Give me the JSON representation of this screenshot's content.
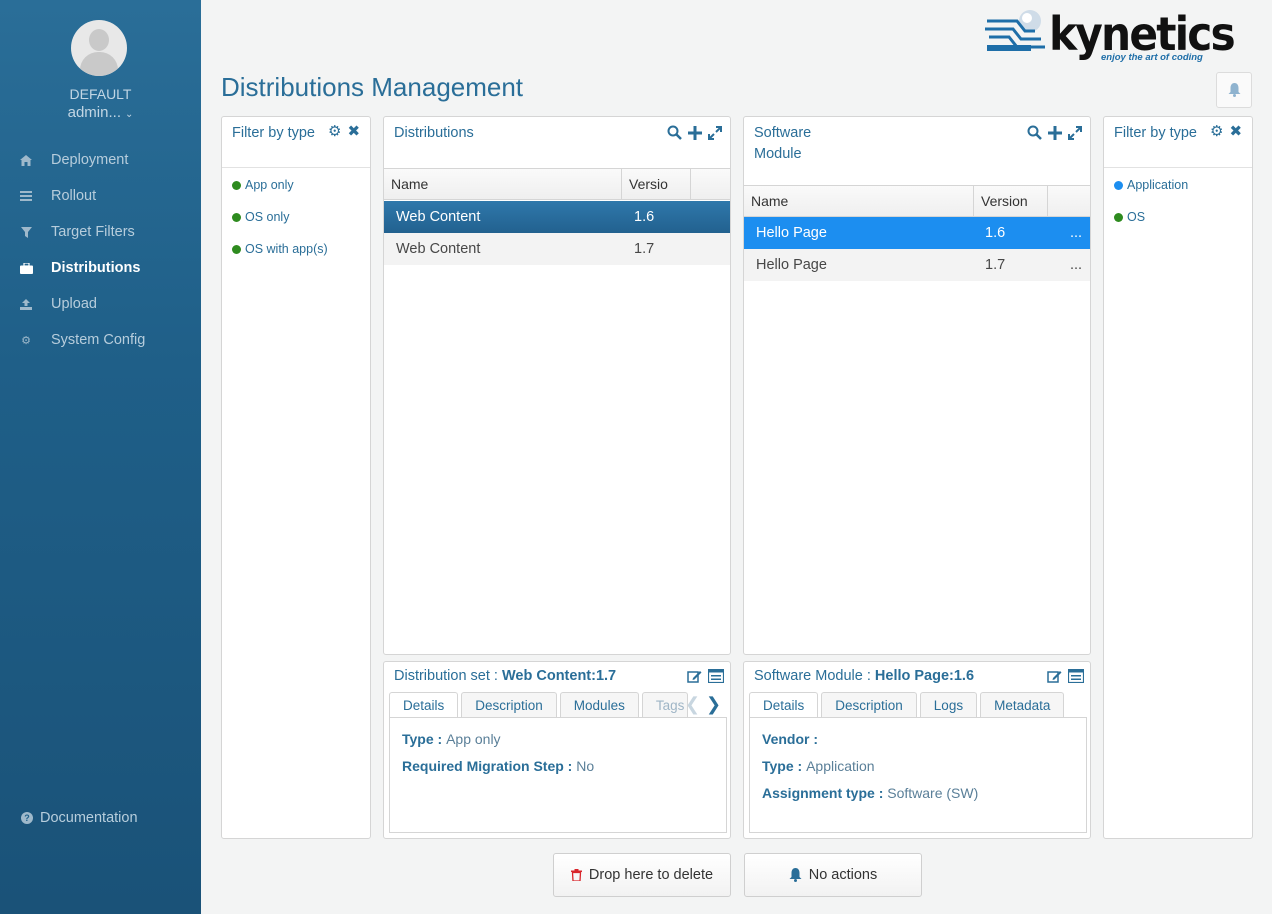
{
  "sidebar": {
    "tenant": "DEFAULT",
    "user": "admin...",
    "items": [
      {
        "label": "Deployment",
        "icon": "home-icon"
      },
      {
        "label": "Rollout",
        "icon": "list-icon"
      },
      {
        "label": "Target Filters",
        "icon": "filter-icon"
      },
      {
        "label": "Distributions",
        "icon": "briefcase-icon"
      },
      {
        "label": "Upload",
        "icon": "upload-icon"
      },
      {
        "label": "System Config",
        "icon": "gear-icon"
      }
    ],
    "active": "Distributions",
    "documentation": "Documentation"
  },
  "header": {
    "title": "Distributions Management",
    "logo_text": "kynetics",
    "logo_tagline": "enjoy the art of coding"
  },
  "dist_filter": {
    "title": "Filter by type",
    "items": [
      {
        "label": "App only",
        "color": "#2e8b1f"
      },
      {
        "label": "OS only",
        "color": "#2e8b1f"
      },
      {
        "label": "OS with app(s)",
        "color": "#2e8b1f"
      }
    ]
  },
  "distributions": {
    "title": "Distributions",
    "columns": [
      "Name",
      "Versio"
    ],
    "rows": [
      {
        "name": "Web Content",
        "version": "1.6",
        "selected": true
      },
      {
        "name": "Web Content",
        "version": "1.7",
        "selected": false
      }
    ]
  },
  "software_module": {
    "title_line1": "Software",
    "title_line2": "Module",
    "columns": [
      "Name",
      "Version"
    ],
    "rows": [
      {
        "name": "Hello Page",
        "version": "1.6",
        "more": "...",
        "selected": true
      },
      {
        "name": "Hello Page",
        "version": "1.7",
        "more": "...",
        "selected": false
      }
    ]
  },
  "sm_filter": {
    "title": "Filter by type",
    "items": [
      {
        "label": "Application",
        "color": "#1c8ef0"
      },
      {
        "label": "OS",
        "color": "#2e8b1f"
      }
    ]
  },
  "dist_details": {
    "prefix": "Distribution set : ",
    "name": "Web Content:1.7",
    "tabs": [
      "Details",
      "Description",
      "Modules",
      "Tags"
    ],
    "fields": [
      {
        "key": "Type : ",
        "value": "App only"
      },
      {
        "key": "Required Migration Step : ",
        "value": "No"
      }
    ]
  },
  "sm_details": {
    "prefix": "Software Module : ",
    "name": "Hello Page:1.6",
    "tabs": [
      "Details",
      "Description",
      "Logs",
      "Metadata"
    ],
    "fields": [
      {
        "key": "Vendor : ",
        "value": ""
      },
      {
        "key": "Type : ",
        "value": "Application"
      },
      {
        "key": "Assignment type : ",
        "value": "Software (SW)"
      }
    ]
  },
  "footer": {
    "delete_label": "Drop here to delete",
    "actions_label": "No actions"
  },
  "colors": {
    "sidebar": "#1f5f88",
    "accent": "#2a6e98",
    "selected_dark": "#22618f",
    "selected_light": "#1c8ef0",
    "delete_icon": "#d9262c"
  }
}
